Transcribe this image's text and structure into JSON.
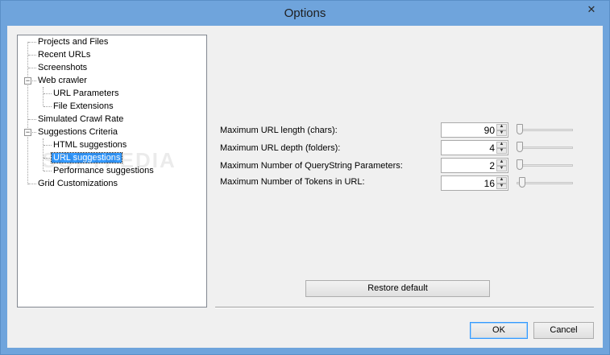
{
  "window": {
    "title": "Options",
    "close_label": "✕"
  },
  "tree": {
    "items": [
      {
        "label": "Projects and Files"
      },
      {
        "label": "Recent URLs"
      },
      {
        "label": "Screenshots"
      },
      {
        "label": "Web crawler",
        "expanded": true
      },
      {
        "label": "URL Parameters"
      },
      {
        "label": "File Extensions"
      },
      {
        "label": "Simulated Crawl Rate"
      },
      {
        "label": "Suggestions Criteria",
        "expanded": true
      },
      {
        "label": "HTML suggestions"
      },
      {
        "label": "URL suggestions",
        "selected": true
      },
      {
        "label": "Performance suggestions"
      },
      {
        "label": "Grid Customizations"
      }
    ],
    "expander_symbol": "−"
  },
  "settings": [
    {
      "label": "Maximum URL length (chars):",
      "value": "90",
      "slider_fraction": 0.0
    },
    {
      "label": "Maximum URL depth (folders):",
      "value": "4",
      "slider_fraction": 0.0
    },
    {
      "label": "Maximum Number of QueryString Parameters:",
      "value": "2",
      "slider_fraction": 0.0
    },
    {
      "label": "Maximum Number of Tokens in URL:",
      "value": "16",
      "slider_fraction": 0.05
    }
  ],
  "spin": {
    "up": "▲",
    "down": "▼"
  },
  "buttons": {
    "restore_default": "Restore default",
    "ok": "OK",
    "cancel": "Cancel"
  },
  "watermark": "SOFTPEDIA"
}
